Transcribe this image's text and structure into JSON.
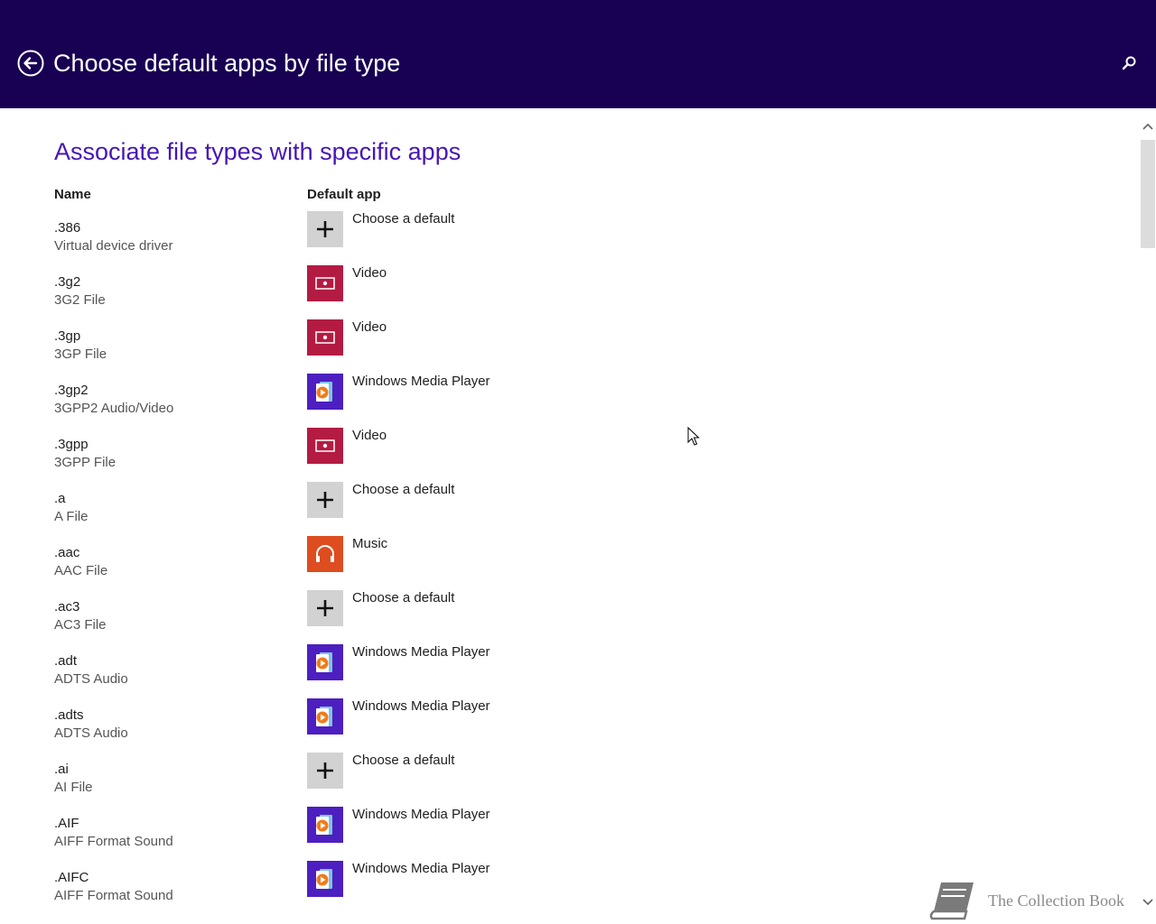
{
  "header": {
    "title": "Choose default apps by file type",
    "back_icon": "back-arrow-icon",
    "search_icon": "search-icon",
    "background": "#180052"
  },
  "main": {
    "section_title": "Associate file types with specific apps",
    "columns": {
      "name": "Name",
      "default_app": "Default app"
    },
    "rows": [
      {
        "ext": ".386",
        "desc": "Virtual device driver",
        "app": "Choose a default",
        "icon": "plus-icon"
      },
      {
        "ext": ".3g2",
        "desc": "3G2 File",
        "app": "Video",
        "icon": "video-icon"
      },
      {
        "ext": ".3gp",
        "desc": "3GP File",
        "app": "Video",
        "icon": "video-icon"
      },
      {
        "ext": ".3gp2",
        "desc": "3GPP2 Audio/Video",
        "app": "Windows Media Player",
        "icon": "windows-media-player-icon"
      },
      {
        "ext": ".3gpp",
        "desc": "3GPP File",
        "app": "Video",
        "icon": "video-icon"
      },
      {
        "ext": ".a",
        "desc": "A File",
        "app": "Choose a default",
        "icon": "plus-icon"
      },
      {
        "ext": ".aac",
        "desc": "AAC File",
        "app": "Music",
        "icon": "headphones-icon"
      },
      {
        "ext": ".ac3",
        "desc": "AC3 File",
        "app": "Choose a default",
        "icon": "plus-icon"
      },
      {
        "ext": ".adt",
        "desc": "ADTS Audio",
        "app": "Windows Media Player",
        "icon": "windows-media-player-icon"
      },
      {
        "ext": ".adts",
        "desc": "ADTS Audio",
        "app": "Windows Media Player",
        "icon": "windows-media-player-icon"
      },
      {
        "ext": ".ai",
        "desc": "AI File",
        "app": "Choose a default",
        "icon": "plus-icon"
      },
      {
        "ext": ".AIF",
        "desc": "AIFF Format Sound",
        "app": "Windows Media Player",
        "icon": "windows-media-player-icon"
      },
      {
        "ext": ".AIFC",
        "desc": "AIFF Format Sound",
        "app": "Windows Media Player",
        "icon": "windows-media-player-icon"
      }
    ]
  },
  "watermark": {
    "text": "The Collection Book",
    "icon": "book-icon"
  },
  "colors": {
    "accent": "#4617b4",
    "video_tile": "#b31b43",
    "music_tile": "#dd4d1f",
    "wmp_tile": "#4d1fc0",
    "plus_tile": "#d2d2d2"
  }
}
